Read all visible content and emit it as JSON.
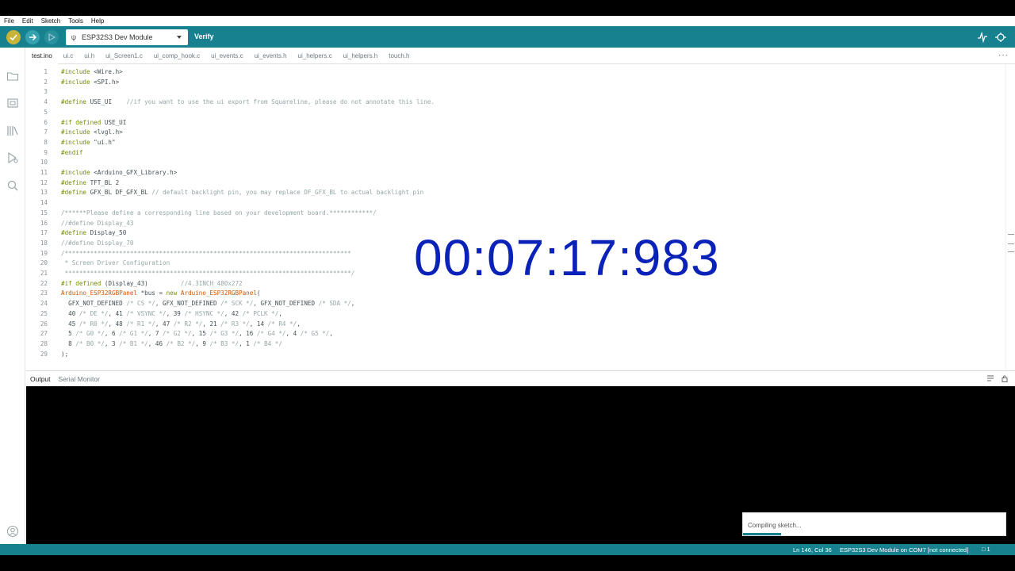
{
  "menu": [
    "File",
    "Edit",
    "Sketch",
    "Tools",
    "Help"
  ],
  "toolbar": {
    "board": "ESP32S3 Dev Module",
    "hover_label": "Verify"
  },
  "tabs": [
    "test.ino",
    "ui.c",
    "ui.h",
    "ui_Screen1.c",
    "ui_comp_hook.c",
    "ui_events.c",
    "ui_events.h",
    "ui_helpers.c",
    "ui_helpers.h",
    "touch.h"
  ],
  "tabs_more": "···",
  "editor": {
    "lines": [
      {
        "n": "1",
        "t": "#include <Wire.h>"
      },
      {
        "n": "2",
        "t": "#include <SPI.h>"
      },
      {
        "n": "3",
        "t": ""
      },
      {
        "n": "4",
        "t": "#define USE_UI    //if you want to use the ui export from Squareline, please do not annotate this line."
      },
      {
        "n": "5",
        "t": ""
      },
      {
        "n": "6",
        "t": "#if defined USE_UI"
      },
      {
        "n": "7",
        "t": "#include <lvgl.h>"
      },
      {
        "n": "8",
        "t": "#include \"ui.h\""
      },
      {
        "n": "9",
        "t": "#endif"
      },
      {
        "n": "10",
        "t": ""
      },
      {
        "n": "11",
        "t": "#include <Arduino_GFX_Library.h>"
      },
      {
        "n": "12",
        "t": "#define TFT_BL 2"
      },
      {
        "n": "13",
        "t": "#define GFX_BL DF_GFX_BL // default backlight pin, you may replace DF_GFX_BL to actual backlight pin"
      },
      {
        "n": "14",
        "t": ""
      },
      {
        "n": "15",
        "t": "/******Please define a corresponding line based on your development board.************/"
      },
      {
        "n": "16",
        "t": "//#define Display_43"
      },
      {
        "n": "17",
        "t": "#define Display_50"
      },
      {
        "n": "18",
        "t": "//#define Display_70"
      },
      {
        "n": "19",
        "t": "/*******************************************************************************"
      },
      {
        "n": "20",
        "t": " * Screen Driver Configuration"
      },
      {
        "n": "21",
        "t": " *******************************************************************************/"
      },
      {
        "n": "22",
        "t": "#if defined (Display_43)         //4.3INCH 480x272"
      },
      {
        "n": "23",
        "t": "Arduino_ESP32RGBPanel *bus = new Arduino_ESP32RGBPanel("
      },
      {
        "n": "24",
        "t": "  GFX_NOT_DEFINED /* CS */, GFX_NOT_DEFINED /* SCK */, GFX_NOT_DEFINED /* SDA */,"
      },
      {
        "n": "25",
        "t": "  40 /* DE */, 41 /* VSYNC */, 39 /* HSYNC */, 42 /* PCLK */,"
      },
      {
        "n": "26",
        "t": "  45 /* R0 */, 48 /* R1 */, 47 /* R2 */, 21 /* R3 */, 14 /* R4 */,"
      },
      {
        "n": "27",
        "t": "  5 /* G0 */, 6 /* G1 */, 7 /* G2 */, 15 /* G3 */, 16 /* G4 */, 4 /* G5 */,"
      },
      {
        "n": "28",
        "t": "  8 /* B0 */, 3 /* B1 */, 46 /* B2 */, 9 /* B3 */, 1 /* B4 */"
      },
      {
        "n": "29",
        "t": ");"
      }
    ]
  },
  "timer_overlay": "00:07:17:983",
  "output": {
    "tabs": [
      "Output",
      "Serial Monitor"
    ]
  },
  "notification": {
    "message": "Compiling sketch..."
  },
  "status": {
    "position": "Ln 146, Col 36",
    "board": "ESP32S3 Dev Module on COM7 [not connected]",
    "notifications": "1"
  },
  "colors": {
    "accent": "#17818f",
    "timer": "#0a22b8"
  }
}
